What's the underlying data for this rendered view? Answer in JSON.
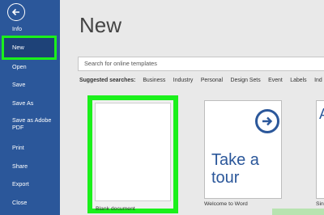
{
  "sidebar": {
    "items": [
      {
        "label": "Info"
      },
      {
        "label": "New"
      },
      {
        "label": "Open"
      },
      {
        "label": "Save"
      },
      {
        "label": "Save As"
      },
      {
        "label": "Save as Adobe PDF"
      },
      {
        "label": "Print"
      },
      {
        "label": "Share"
      },
      {
        "label": "Export"
      },
      {
        "label": "Close"
      }
    ]
  },
  "main": {
    "title": "New",
    "search": {
      "placeholder": "Search for online templates"
    },
    "suggested": {
      "label": "Suggested searches:",
      "items": [
        "Business",
        "Industry",
        "Personal",
        "Design Sets",
        "Event",
        "Labels",
        "Ind"
      ]
    },
    "templates": [
      {
        "label": "Blank document"
      },
      {
        "label": "Welcome to Word",
        "preview_text": "Take a tour"
      },
      {
        "label": "Sin"
      }
    ]
  },
  "colors": {
    "sidebar": "#2b579a",
    "highlight": "#1bf01b",
    "background": "#e9e9e9",
    "accent": "#2b579a"
  },
  "icons": {
    "back": "back-arrow-icon",
    "tour": "right-arrow-icon"
  }
}
